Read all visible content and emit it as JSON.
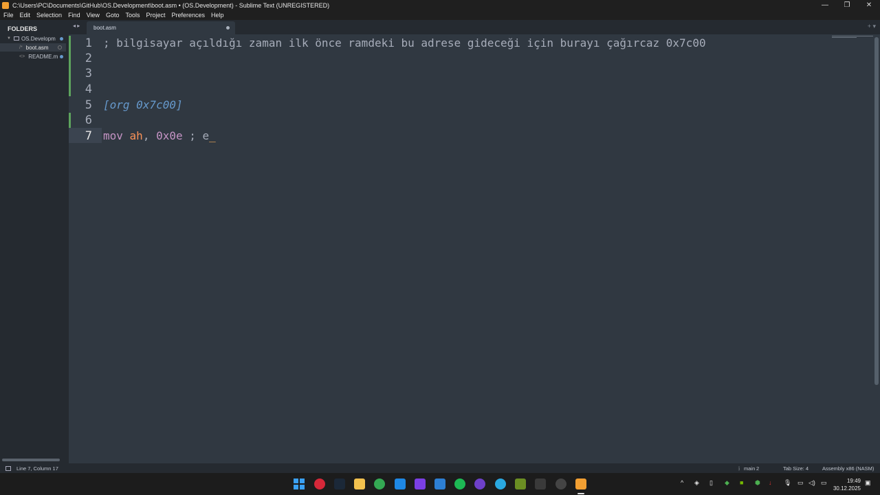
{
  "window": {
    "title": "C:\\Users\\PC\\Documents\\GitHub\\OS.Development\\boot.asm • (OS.Development) - Sublime Text (UNREGISTERED)",
    "controls": [
      "—",
      "❐",
      "✕"
    ]
  },
  "menu": [
    "File",
    "Edit",
    "Selection",
    "Find",
    "View",
    "Goto",
    "Tools",
    "Project",
    "Preferences",
    "Help"
  ],
  "sidebar": {
    "header": "FOLDERS",
    "folder": "OS.Developm",
    "files": [
      {
        "name": "boot.asm",
        "prefix": "/*"
      },
      {
        "name": "README.m",
        "prefix": "<>"
      }
    ]
  },
  "tabs": {
    "nav": "◂ ▸",
    "active": "boot.asm",
    "right": "+ ▾"
  },
  "editor": {
    "line_numbers": [
      "1",
      "2",
      "3",
      "4",
      "5",
      "6",
      "7"
    ],
    "lines": [
      "; bilgisayar açıldığı zaman ilk önce ramdeki bu adrese gideceği için burayı çağırcaz 0x7c00",
      "",
      "",
      "",
      "[org 0x7c00]",
      "",
      "mov ah, 0x0e ; e"
    ],
    "line7": {
      "kw": "mov",
      "reg": "ah",
      "comma": ",",
      "num": "0x0e",
      "comment": "; e",
      "cursor": "_"
    }
  },
  "status": {
    "position": "Line 7, Column 17",
    "branch": "main",
    "branch_count": "2",
    "tab_size": "Tab Size: 4",
    "syntax": "Assembly x86 (NASM)"
  },
  "taskbar": {
    "time": "19:49",
    "date": "30.12.2025",
    "tray_chevron": "^"
  },
  "colors": {
    "editor_bg": "#303841",
    "sidebar_bg": "#252a30",
    "comment": "#a7adba",
    "directive": "#6699cc",
    "keyword": "#c594c5",
    "register": "#f99157",
    "modified_gutter": "#5da35d"
  }
}
